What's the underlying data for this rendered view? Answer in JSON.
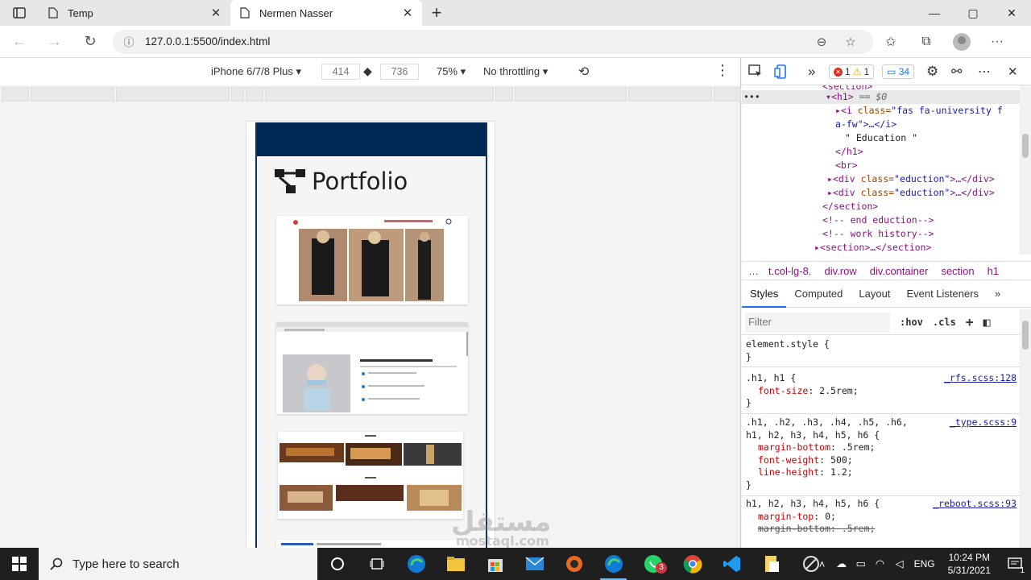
{
  "browser": {
    "tabs": [
      {
        "title": "Temp"
      },
      {
        "title": "Nermen Nasser"
      }
    ],
    "new_tab": "+",
    "window": {
      "minimize": "—",
      "maximize": "▢",
      "close": "✕"
    },
    "address": "127.0.0.1:5500/index.html"
  },
  "device_toolbar": {
    "device": "iPhone 6/7/8 Plus",
    "width": "414",
    "height": "736",
    "zoom": "75%",
    "throttling": "No throttling",
    "more": "⋮"
  },
  "page": {
    "brand_title": "Portfolio",
    "header_color": "#002855"
  },
  "devtools": {
    "issues": {
      "errors": "1",
      "warnings": "1",
      "messages": "34"
    },
    "dom": {
      "l0": "<section>",
      "l1_tag": "<h1>",
      "l1_eq": " == $0",
      "l2_open": "<i ",
      "l2_attr": "class=",
      "l2_val": "\"fas fa-university f",
      "l3": "a-fw\">…</i>",
      "l4": "\" Education \"",
      "l5": "</h1>",
      "l6": "<br>",
      "l7_open": "<div ",
      "l7_attr": "class=",
      "l7_val": "\"eduction\"",
      "l7_close": ">…</div>",
      "l9": "</section>",
      "l10": "<!-- end eduction-->",
      "l11": "<!--  work history-->",
      "l12": "<section>…</section>"
    },
    "breadcrumbs": [
      "…",
      "t.col-lg-8.",
      "div.row",
      "div.container",
      "section",
      "h1"
    ],
    "subtabs": [
      "Styles",
      "Computed",
      "Layout",
      "Event Listeners",
      "»"
    ],
    "filter_placeholder": "Filter",
    "filter_tools": [
      ":hov",
      ".cls",
      "+"
    ],
    "rules": [
      {
        "selector": "element.style {",
        "source": "",
        "decls": [],
        "close": "}"
      },
      {
        "selector": ".h1, h1 {",
        "source": "_rfs.scss:128",
        "decls": [
          {
            "prop": "font-size",
            "val": "2.5rem;"
          }
        ],
        "close": "}"
      },
      {
        "selector": ".h1, .h2, .h3, .h4, .h5, .h6,",
        "selector2": "h1, h2, h3, h4, h5, h6 {",
        "source": "_type.scss:9",
        "decls": [
          {
            "prop": "margin-bottom",
            "val": ".5rem;"
          },
          {
            "prop": "font-weight",
            "val": "500;"
          },
          {
            "prop": "line-height",
            "val": "1.2;"
          }
        ],
        "close": "}"
      },
      {
        "selector": "h1, h2, h3, h4, h5, h6 {",
        "source": "_reboot.scss:93",
        "decls": [
          {
            "prop": "margin-top",
            "val": "0;"
          },
          {
            "prop": "margin-bottom",
            "val": ".5rem;"
          }
        ],
        "close": ""
      }
    ]
  },
  "taskbar": {
    "search_placeholder": "Type here to search",
    "language": "ENG",
    "time": "10:24 PM",
    "date": "5/31/2021",
    "notification_count": "1",
    "whatsapp_badge": "3"
  },
  "watermark": {
    "text": "مستقل",
    "sub": "mostaql.com"
  }
}
